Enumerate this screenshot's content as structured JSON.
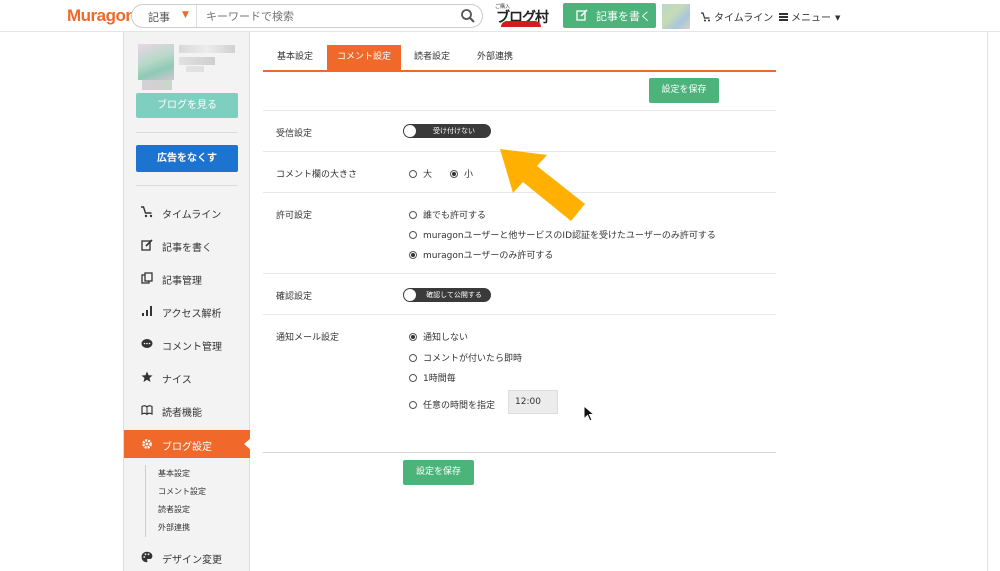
{
  "header": {
    "logo": "Muragon",
    "search_category": "記事",
    "search_placeholder": "キーワードで検索",
    "blogmura_small": "ご購入",
    "blogmura_text": "ブログ村",
    "write_button": "記事を書く",
    "timeline_link": "タイムライン",
    "menu_link": "メニュー"
  },
  "sidebar": {
    "view_blog_button": "ブログを見る",
    "remove_ads_button": "広告をなくす",
    "nav_items": [
      {
        "label": "タイムライン",
        "icon": "cart-icon"
      },
      {
        "label": "記事を書く",
        "icon": "pen-icon"
      },
      {
        "label": "記事管理",
        "icon": "copy-icon"
      },
      {
        "label": "アクセス解析",
        "icon": "bar-chart-icon"
      },
      {
        "label": "コメント管理",
        "icon": "comment-icon"
      },
      {
        "label": "ナイス",
        "icon": "star-icon"
      },
      {
        "label": "読者機能",
        "icon": "book-icon"
      },
      {
        "label": "ブログ設定",
        "icon": "gear-icon",
        "active": true
      }
    ],
    "sub_items": [
      "基本設定",
      "コメント設定",
      "読者設定",
      "外部連携"
    ],
    "design_item": "デザイン変更"
  },
  "tabs": [
    {
      "label": "基本設定",
      "active": false
    },
    {
      "label": "コメント設定",
      "active": true
    },
    {
      "label": "読者設定",
      "active": false
    },
    {
      "label": "外部連携",
      "active": false
    }
  ],
  "save_button": "設定を保存",
  "settings": {
    "receive": {
      "label": "受信設定",
      "toggle_text": "受け付けない"
    },
    "size": {
      "label": "コメント欄の大きさ",
      "options": [
        "大",
        "小"
      ],
      "selected": 1
    },
    "permission": {
      "label": "許可設定",
      "options": [
        "誰でも許可する",
        "muragonユーザーと他サービスのID認証を受けたユーザーのみ許可する",
        "muragonユーザーのみ許可する"
      ],
      "selected": 2
    },
    "confirm": {
      "label": "確認設定",
      "toggle_text": "確認して公開する"
    },
    "notify": {
      "label": "通知メール設定",
      "options": [
        "通知しない",
        "コメントが付いたら即時",
        "1時間毎",
        "任意の時間を指定"
      ],
      "selected": 0,
      "time_value": "12:00"
    }
  },
  "colors": {
    "accent": "#f0692a",
    "save_green": "#4cb47a",
    "ads_blue": "#1d74d0",
    "view_teal": "#7fcfc0",
    "arrow": "#ffb000"
  }
}
